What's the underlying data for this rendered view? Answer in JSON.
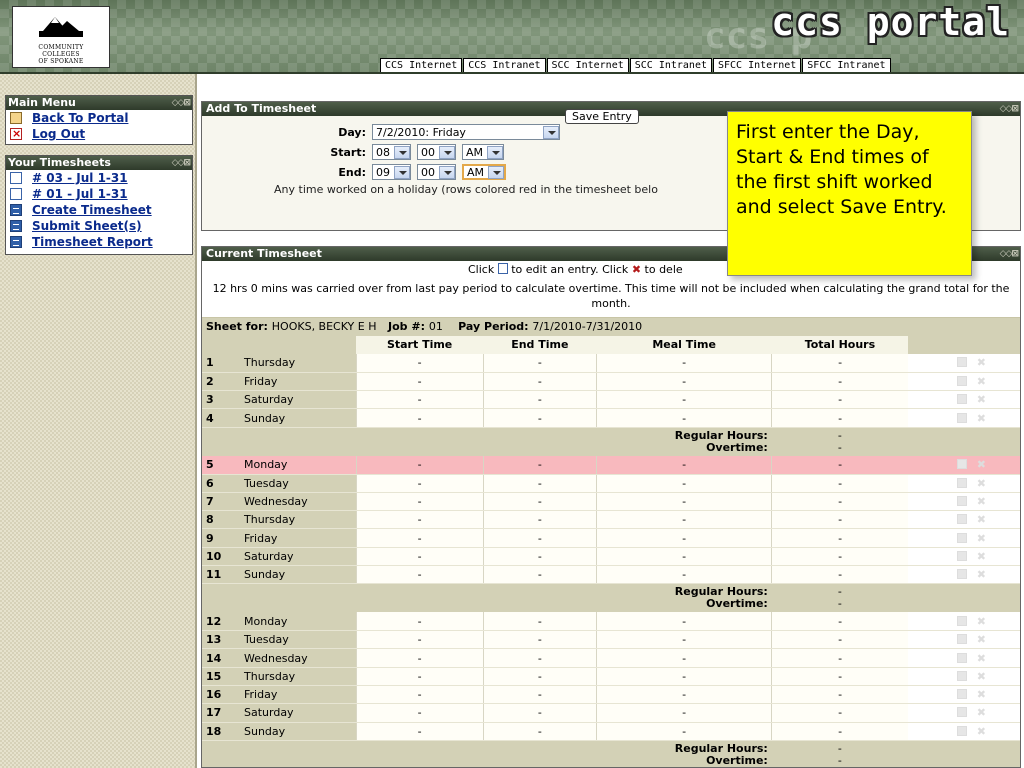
{
  "header": {
    "logo_lines": [
      "COMMUNITY",
      "COLLEGES",
      "OF SPOKANE"
    ],
    "brand_ghost": "ccs p",
    "brand": "ccs portal",
    "links": [
      "CCS Internet",
      "CCS Intranet",
      "SCC Internet",
      "SCC Intranet",
      "SFCC Internet",
      "SFCC Intranet"
    ]
  },
  "sidebar": {
    "main_menu": {
      "title": "Main Menu",
      "items": [
        {
          "label": "Back To Portal",
          "icon": "home-icon"
        },
        {
          "label": "Log Out",
          "icon": "logout-icon"
        }
      ]
    },
    "timesheets": {
      "title": "Your Timesheets",
      "items": [
        {
          "label": "# 03 - Jul 1-31",
          "icon": "document-icon"
        },
        {
          "label": "# 01 - Jul 1-31",
          "icon": "document-icon"
        },
        {
          "label": "Create Timesheet",
          "icon": "grid-icon"
        },
        {
          "label": "Submit Sheet(s)",
          "icon": "grid-icon"
        },
        {
          "label": "Timesheet Report",
          "icon": "grid-icon"
        }
      ]
    }
  },
  "main": {
    "add_title": "Add To Timesheet",
    "form": {
      "day_label": "Day:",
      "day_value": "7/2/2010: Friday",
      "start_label": "Start:",
      "start_hour": "08",
      "start_min": "00",
      "start_ampm": "AM",
      "end_label": "End:",
      "end_hour": "09",
      "end_min": "00",
      "end_ampm": "AM",
      "holiday_note": "Any time worked on a holiday (rows colored red in the timesheet belo",
      "save_label": "Save Entry"
    },
    "current_title": "Current Timesheet",
    "click_note_prefix": "Click",
    "click_note_mid": "to edit an entry. Click",
    "click_note_suffix": "to dele",
    "carry_note": "12 hrs 0 mins was carried over from last pay period to calculate overtime. This time will not be included when calculating the grand total for the month.",
    "sheet_info": {
      "sheet_for_label": "Sheet for:",
      "name": "HOOKS, BECKY E H",
      "job_label": "Job #:",
      "job": "01",
      "pay_period_label": "Pay Period:",
      "pay_period": "7/1/2010-7/31/2010"
    },
    "columns": [
      "Start Time",
      "End Time",
      "Meal Time",
      "Total Hours"
    ],
    "placeholder": "-",
    "regular_hours_label": "Regular Hours:",
    "overtime_label": "Overtime:",
    "weeks": [
      [
        {
          "num": "1",
          "day": "Thursday"
        },
        {
          "num": "2",
          "day": "Friday"
        },
        {
          "num": "3",
          "day": "Saturday"
        },
        {
          "num": "4",
          "day": "Sunday"
        }
      ],
      [
        {
          "num": "5",
          "day": "Monday",
          "holiday": true
        },
        {
          "num": "6",
          "day": "Tuesday"
        },
        {
          "num": "7",
          "day": "Wednesday"
        },
        {
          "num": "8",
          "day": "Thursday"
        },
        {
          "num": "9",
          "day": "Friday"
        },
        {
          "num": "10",
          "day": "Saturday"
        },
        {
          "num": "11",
          "day": "Sunday"
        }
      ],
      [
        {
          "num": "12",
          "day": "Monday"
        },
        {
          "num": "13",
          "day": "Tuesday"
        },
        {
          "num": "14",
          "day": "Wednesday"
        },
        {
          "num": "15",
          "day": "Thursday"
        },
        {
          "num": "16",
          "day": "Friday"
        },
        {
          "num": "17",
          "day": "Saturday"
        },
        {
          "num": "18",
          "day": "Sunday"
        }
      ]
    ]
  },
  "callout": {
    "text": "First enter the Day, Start & End times of the first shift worked and select Save Entry."
  },
  "colors": {
    "holiday_row": "#f8b9be",
    "callout_bg": "#ffff00",
    "panel_title": "#2e3a2a",
    "link": "#0a2a8c"
  }
}
